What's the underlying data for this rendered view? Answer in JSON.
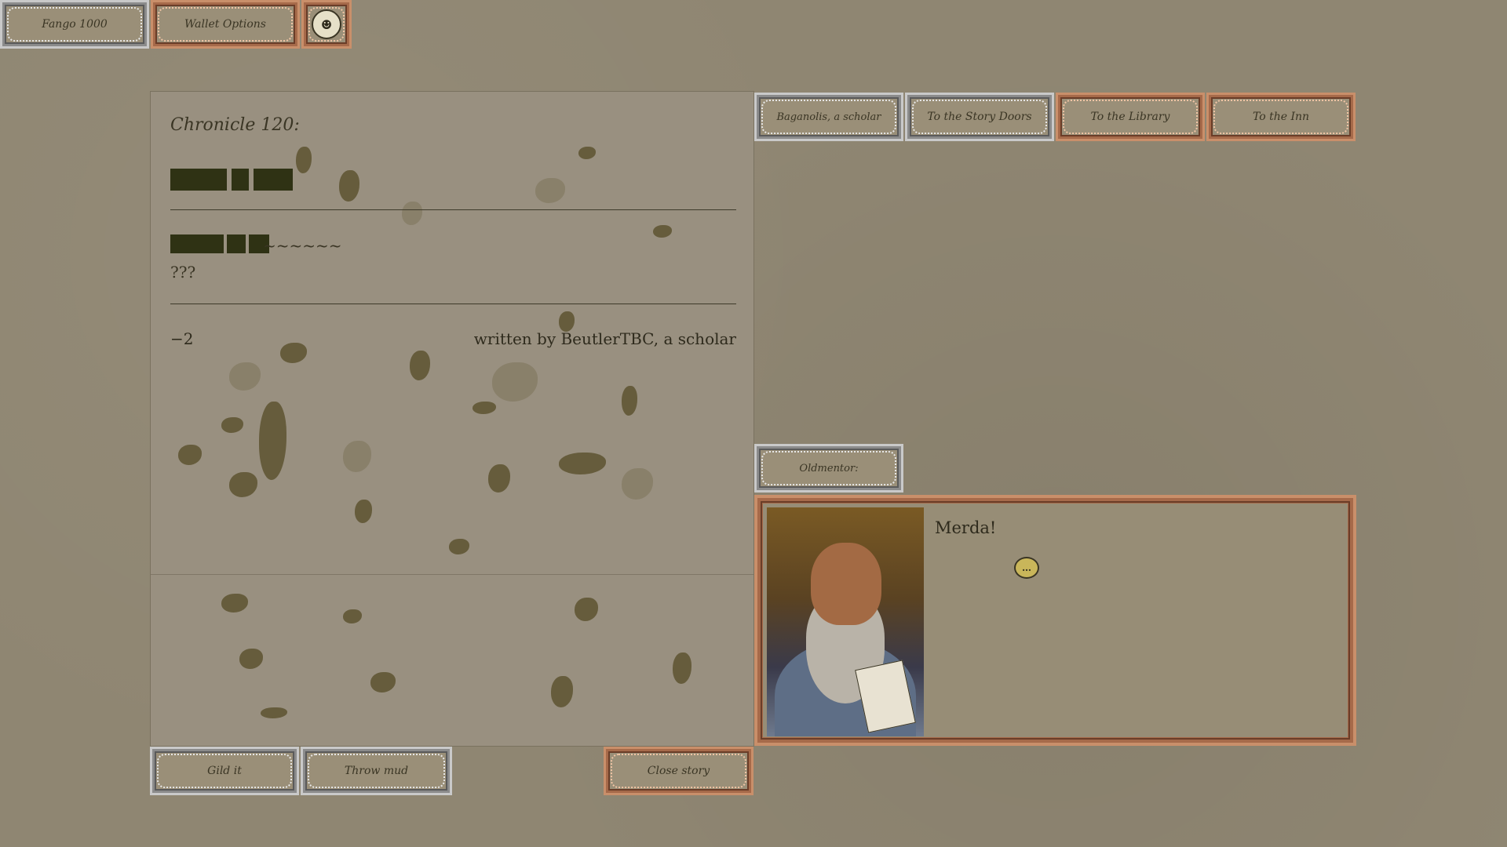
{
  "topbar": {
    "fango_label": "Fango 1000",
    "wallet_label": "Wallet Options",
    "mascot_icon": "goblin-face-icon"
  },
  "story": {
    "chronicle_title": "Chronicle 120:",
    "tilde_text": "~~~~~~",
    "question_text": "???",
    "score": "−2",
    "author": "written by BeutlerTBC, a scholar"
  },
  "actions": {
    "gild_label": "Gild it",
    "mud_label": "Throw mud",
    "close_label": "Close story"
  },
  "nav": {
    "baganolis_label": "Baganolis, a scholar",
    "doors_label": "To the Story Doors",
    "library_label": "To the Library",
    "inn_label": "To the Inn"
  },
  "dialogue": {
    "speaker": "Oldmentor:",
    "text": "Merda!",
    "speech_icon": "speech-bubble-icon"
  },
  "colors": {
    "background": "#8f8672",
    "redaction": "#2f3214",
    "silver_frame": "#c9c9c9",
    "copper_frame": "#c98f6a"
  }
}
